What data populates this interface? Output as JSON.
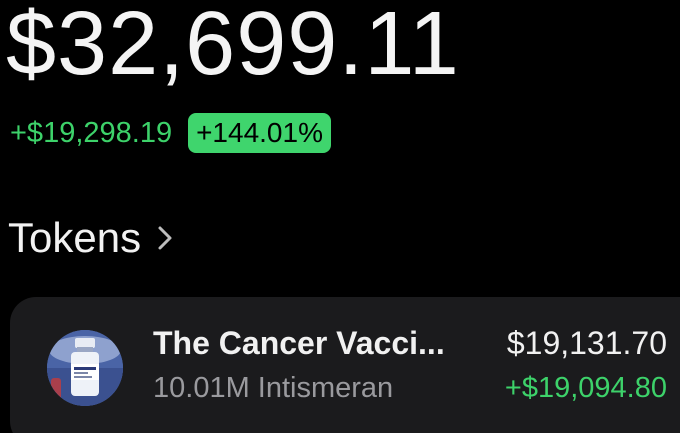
{
  "portfolio": {
    "balance": "$32,699.11",
    "change_amount": "+$19,298.19",
    "change_percent": "+144.01%"
  },
  "tokens_section": {
    "title": "Tokens",
    "chevron_icon": "chevron-right-icon"
  },
  "tokens": [
    {
      "name": "The Cancer Vacci...",
      "quantity": "10.01M Intismeran",
      "value": "$19,131.70",
      "gain": "+$19,094.80",
      "icon": "vaccine-vial-icon"
    }
  ],
  "colors": {
    "background": "#000000",
    "positive": "#3dd26a",
    "badge": "#3fd56d",
    "card": "#1b1b1d",
    "muted": "#9a9a9e"
  }
}
